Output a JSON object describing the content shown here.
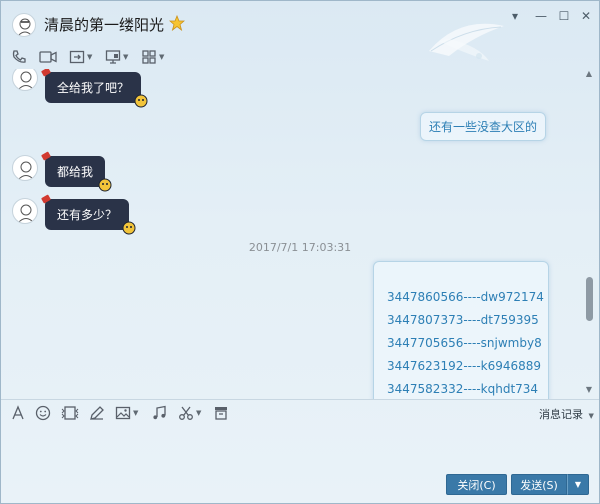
{
  "window": {
    "title": "清晨的第一缕阳光",
    "controls": {
      "minimize": "—",
      "maximize": "☐",
      "close": "✕",
      "menu": "▾"
    }
  },
  "toolbar": {
    "icons": [
      "phone-icon",
      "video-icon",
      "screen-share-icon",
      "remote-desktop-icon",
      "apps-grid-icon"
    ]
  },
  "messages": [
    {
      "side": "left",
      "text": "全给我了吧？"
    },
    {
      "side": "right",
      "text": "还有一些没查大区的"
    },
    {
      "side": "left",
      "text": "都给我"
    },
    {
      "side": "left",
      "text": "还有多少？"
    }
  ],
  "timestamp": "2017/7/1 17:03:31",
  "code_list": [
    "3447860566----dw972174",
    "3447807373----dt759395",
    "3447705656----snjwmby8",
    "3447623192----k6946889",
    "3447582332----kqhdt734"
  ],
  "input_toolbar": {
    "history_label": "消息记录",
    "icons": [
      "font-icon",
      "emoji-icon",
      "gif-icon",
      "pen-icon",
      "image-icon",
      "music-icon",
      "scissors-icon",
      "shake-icon"
    ]
  },
  "buttons": {
    "close_label": "关闭(C)",
    "send_label": "发送(S)"
  },
  "colors": {
    "dark_bubble": "#2a3348",
    "link_blue": "#2d7fb5",
    "button_blue": "#3a79a8"
  }
}
